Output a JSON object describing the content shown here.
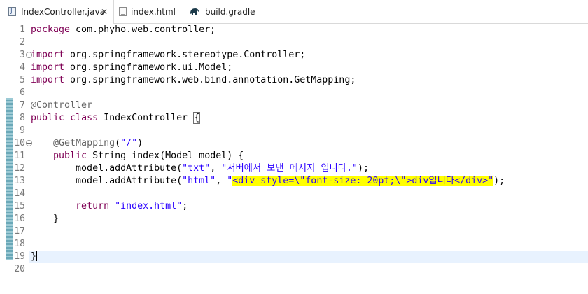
{
  "tabs": [
    {
      "label": "IndexController.java",
      "icon": "java-file-icon",
      "active": true,
      "close": "✕"
    },
    {
      "label": "index.html",
      "icon": "html-file-icon",
      "active": false
    },
    {
      "label": "build.gradle",
      "icon": "gradle-elephant-icon",
      "active": false
    }
  ],
  "editor": {
    "line_numbers": [
      "1",
      "2",
      "3",
      "4",
      "5",
      "6",
      "7",
      "8",
      "9",
      "10",
      "11",
      "12",
      "13",
      "14",
      "15",
      "16",
      "17",
      "18",
      "19",
      "20"
    ],
    "lines": {
      "l1": {
        "kw": "package",
        "rest": " com.phyho.web.controller;"
      },
      "l3": {
        "kw": "import",
        "rest": " org.springframework.stereotype.Controller;"
      },
      "l4": {
        "kw": "import",
        "rest": " org.springframework.ui.Model;"
      },
      "l5": {
        "kw": "import",
        "rest": " org.springframework.web.bind.annotation.GetMapping;"
      },
      "l7": {
        "ann": "@Controller"
      },
      "l8": {
        "kw1": "public",
        "kw2": "class",
        "rest": " IndexController ",
        "brace": "{"
      },
      "l10": {
        "indent": "    ",
        "ann": "@GetMapping",
        "open": "(",
        "str": "\"/\"",
        "close": ")"
      },
      "l11": {
        "indent": "    ",
        "kw": "public",
        "rest": " String index(Model model) {"
      },
      "l12": {
        "indent": "        ",
        "pre": "model.addAttribute(",
        "str1": "\"txt\"",
        "mid": ", ",
        "str2": "\"서버에서 보낸 메시지 입니다.\"",
        "post": ");"
      },
      "l13": {
        "indent": "        ",
        "pre": "model.addAttribute(",
        "str1": "\"html\"",
        "mid": ", ",
        "str_q": "\"",
        "str_hl": "<div style=\\\"font-size: 20pt;\\\">div입니다</div>\"",
        "post": ");"
      },
      "l15": {
        "indent": "        ",
        "kw": "return",
        "sp": " ",
        "str": "\"index.html\"",
        "post": ";"
      },
      "l16": {
        "text": "    }"
      },
      "l19": {
        "text": "}"
      }
    }
  },
  "colors": {
    "keyword": "#7f0055",
    "string": "#2a00ff",
    "annotation": "#646464",
    "highlight": "#ffff00",
    "current_line": "#e8f2fe",
    "marker": "#6aa8b8"
  }
}
